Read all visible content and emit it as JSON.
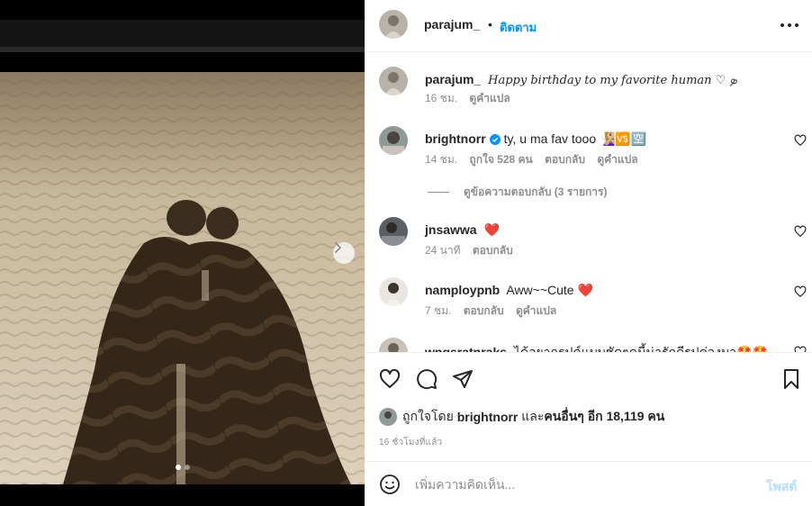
{
  "post": {
    "author": "parajum_",
    "follow_label": "ติดตาม",
    "separator": "•",
    "more_icon": "more-horizontal-icon",
    "carousel": {
      "current_index": 1,
      "total": 2,
      "next_icon": "chevron-right-icon"
    }
  },
  "caption": {
    "username": "parajum_",
    "text": "Happy birthday to my favorite human ♡ ܤ",
    "time": "16 ชม.",
    "translate": "ดูคำแปล"
  },
  "comments": [
    {
      "username": "brightnorr",
      "verified": true,
      "text": "ty, u ma fav tooo 🧏🏼‍♀️🆚🈳",
      "time": "14 ชม.",
      "likes": "ถูกใจ 528 คน",
      "reply": "ตอบกลับ",
      "translate": "ดูคำแปล",
      "view_replies": "ดูข้อความตอบกลับ (3 รายการ)"
    },
    {
      "username": "jnsawwa",
      "text": "❤️",
      "time": "24 นาที",
      "reply": "ตอบกลับ"
    },
    {
      "username": "namploypnb",
      "text": "Aww~~Cute ❤️",
      "time": "7 ชม.",
      "reply": "ตอบกลับ",
      "translate": "ดูคำแปล"
    },
    {
      "username": "wngsratnraks",
      "text": "ได้อยากรปค์แบบชัดๆคนี้น่ารักดีรปค่จงมา🤩🤩"
    }
  ],
  "liked_by": {
    "prefix": "ถูกใจโดย",
    "user": "brightnorr",
    "and": "และ",
    "others": "คนอื่นๆ อีก 18,119 คน"
  },
  "time_ago": "16 ชั่วโมงที่แล้ว",
  "add_comment": {
    "placeholder": "เพิ่มความคิดเห็น...",
    "post_label": "โพสต์"
  },
  "colors": {
    "link_blue": "#0095f6",
    "post_disabled": "#b2dffc",
    "heart_red": "#ed4956"
  }
}
